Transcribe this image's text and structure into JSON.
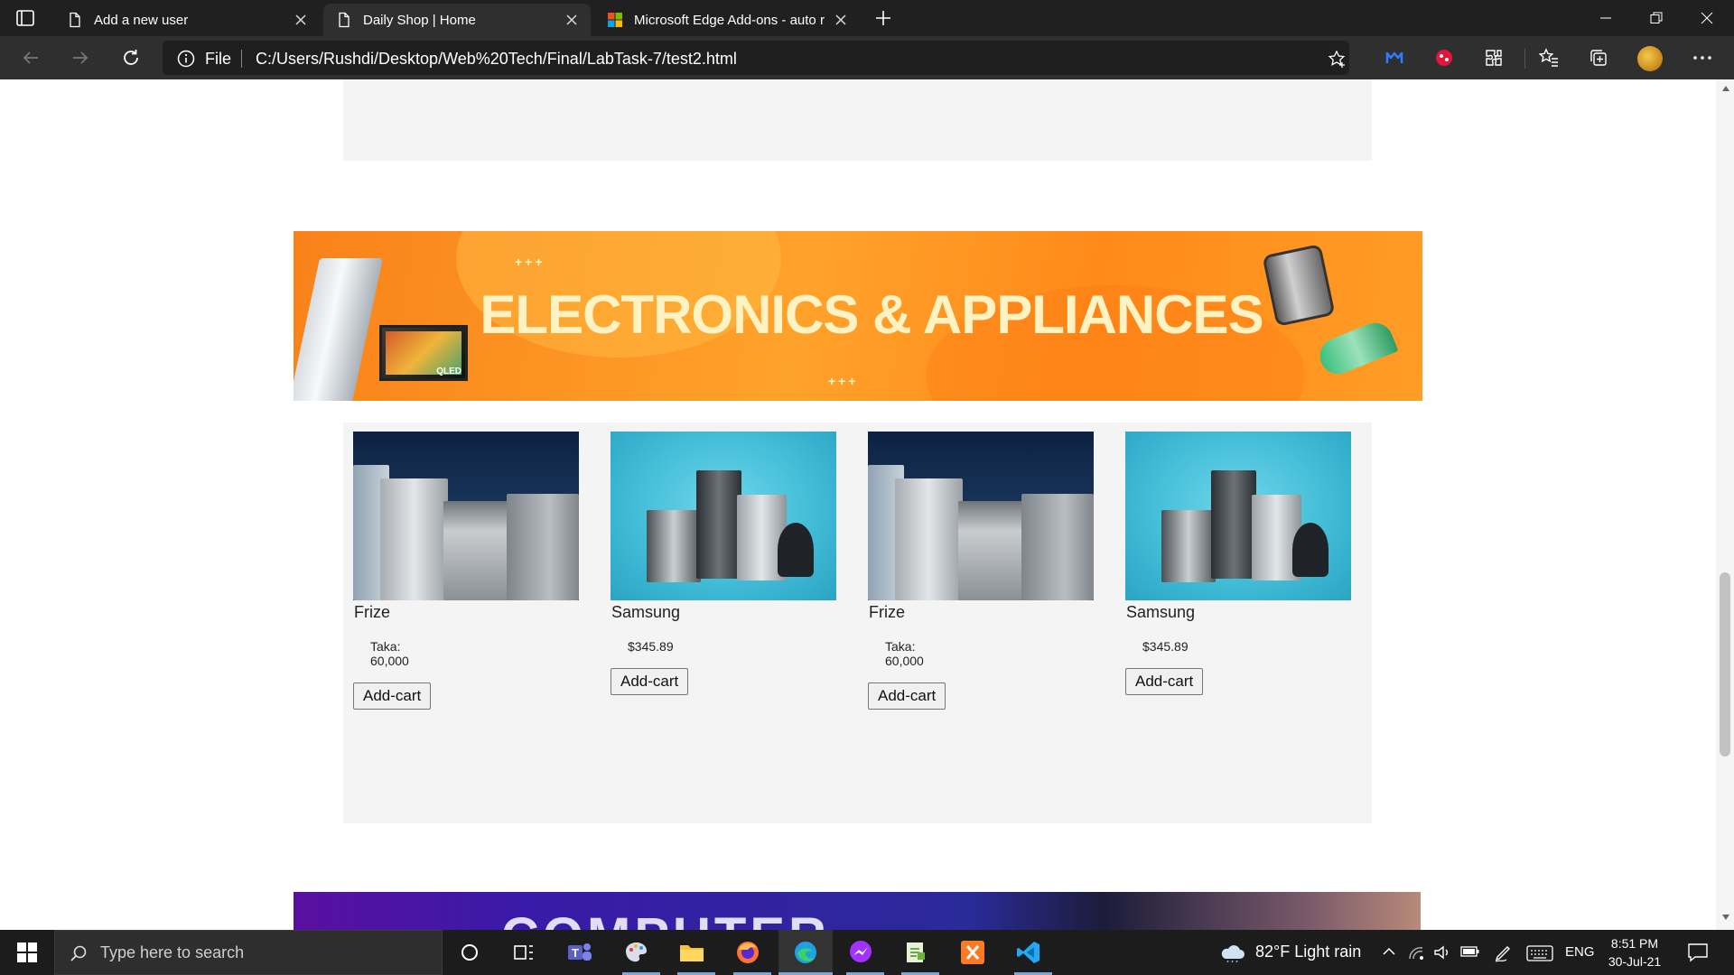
{
  "browser": {
    "tabs": [
      {
        "title": "Add a new user",
        "icon": "page-icon",
        "active": false
      },
      {
        "title": "Daily Shop | Home",
        "icon": "page-icon",
        "active": true
      },
      {
        "title": "Microsoft Edge Add-ons - auto r",
        "icon": "microsoft-logo-icon",
        "active": false
      }
    ],
    "address": {
      "scheme_label": "File",
      "url": "C:/Users/Rushdi/Desktop/Web%20Tech/Final/LabTask-7/test2.html"
    }
  },
  "page": {
    "banner_title": "ELECTRONICS & APPLIANCES",
    "banner_tv_label": "QLED",
    "next_banner_title": "COMPUTER",
    "products": [
      {
        "name": "Frize",
        "price_label": "Taka:",
        "price": "60,000",
        "button": "Add-cart",
        "image": "dark-appliances"
      },
      {
        "name": "Samsung",
        "price_label": "",
        "price": "$345.89",
        "button": "Add-cart",
        "image": "cyan-appliances"
      },
      {
        "name": "Frize",
        "price_label": "Taka:",
        "price": "60,000",
        "button": "Add-cart",
        "image": "dark-appliances"
      },
      {
        "name": "Samsung",
        "price_label": "",
        "price": "$345.89",
        "button": "Add-cart",
        "image": "cyan-appliances"
      }
    ]
  },
  "taskbar": {
    "search_placeholder": "Type here to search",
    "weather": "82°F  Light rain",
    "language": "ENG",
    "time": "8:51 PM",
    "date": "30-Jul-21",
    "apps": [
      "cortana-icon",
      "task-view-icon",
      "teams-icon",
      "paint-icon",
      "file-explorer-icon",
      "firefox-icon",
      "edge-icon",
      "messenger-icon",
      "notepad-icon",
      "xampp-icon",
      "vscode-icon"
    ]
  },
  "colors": {
    "banner_orange": "#ff9420",
    "section_bg": "#f4f4f4",
    "chrome_dark": "#202020",
    "taskbar": "#1c1c1c"
  }
}
